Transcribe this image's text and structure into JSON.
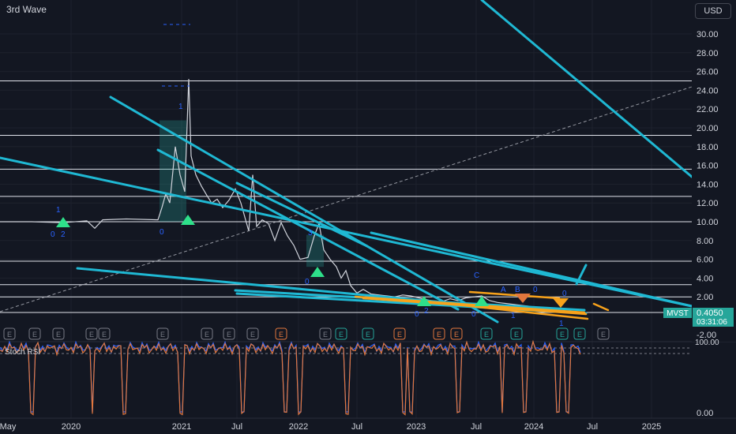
{
  "title": "3rd Wave",
  "currency_button": "USD",
  "stoch_title": "Stoch RSI",
  "price_tag": {
    "symbol": "MVST",
    "price": "0.4050",
    "countdown": "03:31:06"
  },
  "colors": {
    "background": "#131722",
    "trend_line": "#1fb8d3",
    "candle_up": "#26a69a",
    "orange": "#f7a21b",
    "green_triangle": "#2ee08a",
    "blue_num": "#2962ff",
    "stoch_k": "#2962ff",
    "stoch_d": "#e2773d"
  },
  "chart_data": {
    "type": "line",
    "y_ticks": [
      "30.00",
      "28.00",
      "26.00",
      "24.00",
      "22.00",
      "20.00",
      "18.00",
      "16.00",
      "14.00",
      "12.00",
      "10.00",
      "8.00",
      "6.00",
      "4.00",
      "2.00",
      "-2.00"
    ],
    "x_ticks": [
      "May",
      "2020",
      "2021",
      "Jul",
      "2022",
      "Jul",
      "2023",
      "Jul",
      "2024",
      "Jul",
      "2025"
    ],
    "horizontal_levels": [
      25.0,
      19.2,
      15.6,
      12.7,
      10.0,
      5.8,
      3.3,
      2.0
    ],
    "price_series": [
      [
        0,
        10.0
      ],
      [
        40,
        10.0
      ],
      [
        80,
        9.9
      ],
      [
        110,
        10.1
      ],
      [
        120,
        9.3
      ],
      [
        130,
        10.2
      ],
      [
        160,
        10.3
      ],
      [
        200,
        10.2
      ],
      [
        205,
        11.5
      ],
      [
        210,
        13.0
      ],
      [
        215,
        12.0
      ],
      [
        222,
        18.0
      ],
      [
        228,
        15.0
      ],
      [
        234,
        13.2
      ],
      [
        239,
        25.2
      ],
      [
        242,
        17.0
      ],
      [
        248,
        15.0
      ],
      [
        255,
        13.8
      ],
      [
        262,
        12.8
      ],
      [
        268,
        12.0
      ],
      [
        275,
        12.4
      ],
      [
        282,
        11.5
      ],
      [
        290,
        12.3
      ],
      [
        298,
        13.5
      ],
      [
        305,
        12.0
      ],
      [
        310,
        10.5
      ],
      [
        315,
        9.0
      ],
      [
        320,
        15.0
      ],
      [
        325,
        9.5
      ],
      [
        332,
        10.2
      ],
      [
        340,
        9.8
      ],
      [
        348,
        8.0
      ],
      [
        356,
        9.9
      ],
      [
        364,
        8.5
      ],
      [
        372,
        7.5
      ],
      [
        380,
        6.0
      ],
      [
        390,
        6.2
      ],
      [
        398,
        8.5
      ],
      [
        404,
        9.8
      ],
      [
        410,
        7.0
      ],
      [
        418,
        6.0
      ],
      [
        426,
        5.2
      ],
      [
        432,
        4.0
      ],
      [
        438,
        4.8
      ],
      [
        444,
        3.2
      ],
      [
        452,
        2.4
      ],
      [
        460,
        2.8
      ],
      [
        470,
        2.3
      ],
      [
        480,
        2.2
      ],
      [
        490,
        2.1
      ],
      [
        500,
        2.0
      ],
      [
        510,
        2.2
      ],
      [
        520,
        2.1
      ],
      [
        530,
        1.9
      ],
      [
        540,
        1.7
      ],
      [
        550,
        1.5
      ],
      [
        560,
        1.5
      ],
      [
        570,
        1.8
      ],
      [
        580,
        1.6
      ],
      [
        590,
        1.9
      ],
      [
        600,
        2.0
      ],
      [
        610,
        2.1
      ],
      [
        620,
        1.6
      ],
      [
        630,
        1.4
      ],
      [
        640,
        1.3
      ],
      [
        650,
        1.2
      ],
      [
        660,
        1.1
      ],
      [
        670,
        1.0
      ],
      [
        680,
        0.8
      ],
      [
        690,
        0.7
      ],
      [
        700,
        0.6
      ],
      [
        710,
        0.55
      ],
      [
        720,
        0.45
      ],
      [
        730,
        0.42
      ]
    ],
    "stoch_range": [
      0,
      100
    ],
    "stoch_ticks": [
      "100.00",
      "0.00"
    ],
    "wave_labels": [
      "1",
      "0",
      "2",
      "1",
      "0",
      "3",
      "0",
      "0",
      "2",
      "C",
      "0",
      "A",
      "B",
      "0",
      "1",
      "0",
      "1"
    ],
    "earnings_markers": [
      "E",
      "E",
      "E",
      "E",
      "E",
      "E",
      "E",
      "E",
      "E",
      "E",
      "E",
      "E",
      "E",
      "E",
      "E",
      "E",
      "E",
      "E",
      "E",
      "E",
      "E",
      "E",
      "E",
      "E",
      "E",
      "E"
    ]
  }
}
